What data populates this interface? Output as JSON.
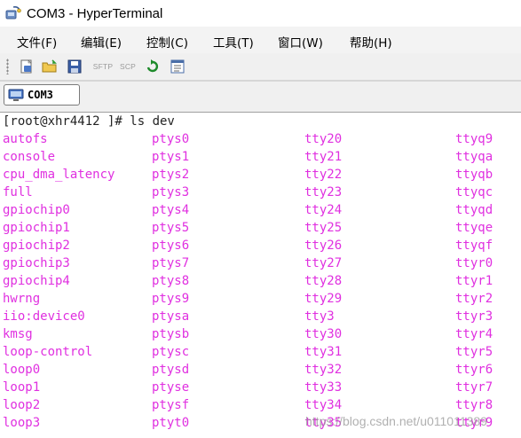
{
  "window": {
    "title": "COM3 - HyperTerminal",
    "icon": "hyperterminal-phone-icon"
  },
  "menu": [
    {
      "label": "文件(F)"
    },
    {
      "label": "编辑(E)"
    },
    {
      "label": "控制(C)"
    },
    {
      "label": "工具(T)"
    },
    {
      "label": "窗口(W)"
    },
    {
      "label": "帮助(H)"
    }
  ],
  "toolbar": {
    "buttons": [
      {
        "name": "new-connection-icon"
      },
      {
        "name": "open-folder-icon"
      },
      {
        "name": "save-disk-icon"
      },
      {
        "name": "sftp-button",
        "label": "SFTP"
      },
      {
        "name": "scp-button",
        "label": "SCP"
      },
      {
        "name": "reconnect-icon"
      },
      {
        "name": "properties-icon"
      }
    ]
  },
  "tabs": [
    {
      "label": "COM3",
      "icon": "terminal-monitor-icon"
    }
  ],
  "terminal": {
    "prompt": "[root@xhr4412 ]# ls dev",
    "columns": [
      [
        "autofs",
        "console",
        "cpu_dma_latency",
        "full",
        "gpiochip0",
        "gpiochip1",
        "gpiochip2",
        "gpiochip3",
        "gpiochip4",
        "hwrng",
        "iio:device0",
        "kmsg",
        "loop-control",
        "loop0",
        "loop1",
        "loop2",
        "loop3"
      ],
      [
        "ptys0",
        "ptys1",
        "ptys2",
        "ptys3",
        "ptys4",
        "ptys5",
        "ptys6",
        "ptys7",
        "ptys8",
        "ptys9",
        "ptysa",
        "ptysb",
        "ptysc",
        "ptysd",
        "ptyse",
        "ptysf",
        "ptyt0"
      ],
      [
        "tty20",
        "tty21",
        "tty22",
        "tty23",
        "tty24",
        "tty25",
        "tty26",
        "tty27",
        "tty28",
        "tty29",
        "tty3",
        "tty30",
        "tty31",
        "tty32",
        "tty33",
        "tty34",
        "tty35"
      ],
      [
        "ttyq9",
        "ttyqa",
        "ttyqb",
        "ttyqc",
        "ttyqd",
        "ttyqe",
        "ttyqf",
        "ttyr0",
        "ttyr1",
        "ttyr2",
        "ttyr3",
        "ttyr4",
        "ttyr5",
        "ttyr6",
        "ttyr7",
        "ttyr8",
        "ttyr9"
      ]
    ],
    "text_color": "#e030e0"
  },
  "watermark": "https://blog.csdn.net/u011011389"
}
